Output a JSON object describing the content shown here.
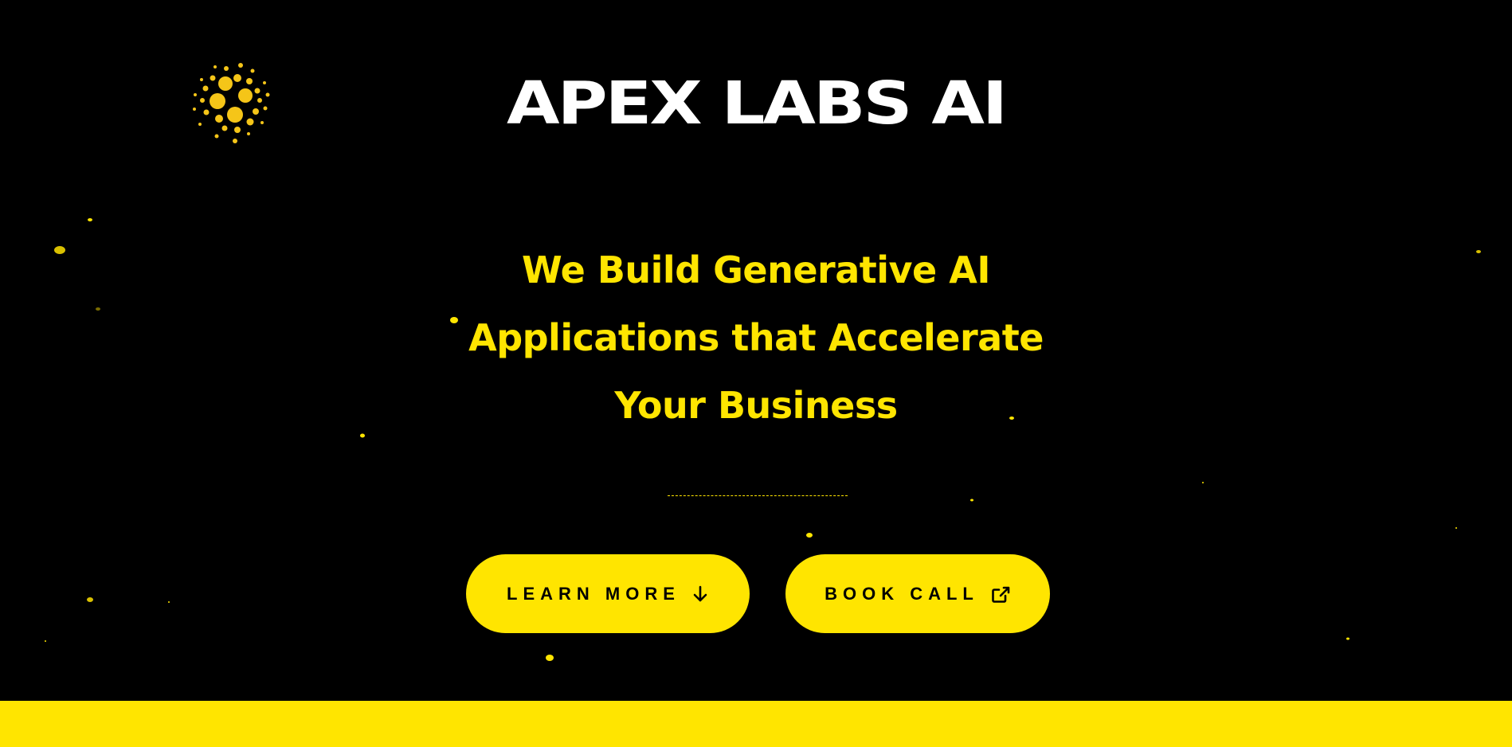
{
  "brand": {
    "name": "APEX LABS AI",
    "logo_icon": "dot-cluster-logo-icon"
  },
  "hero": {
    "headline_lines": [
      "We Build Generative AI",
      "Applications that Accelerate",
      "Your Business"
    ]
  },
  "actions": {
    "learn_more": {
      "label": "LEARN MORE",
      "icon": "arrow-down-icon"
    },
    "book_call": {
      "label": "BOOK CALL",
      "icon": "external-link-icon"
    }
  },
  "colors": {
    "background": "#000000",
    "accent": "#ffe500",
    "brand_text": "#ffffff",
    "button_text": "#000000"
  }
}
